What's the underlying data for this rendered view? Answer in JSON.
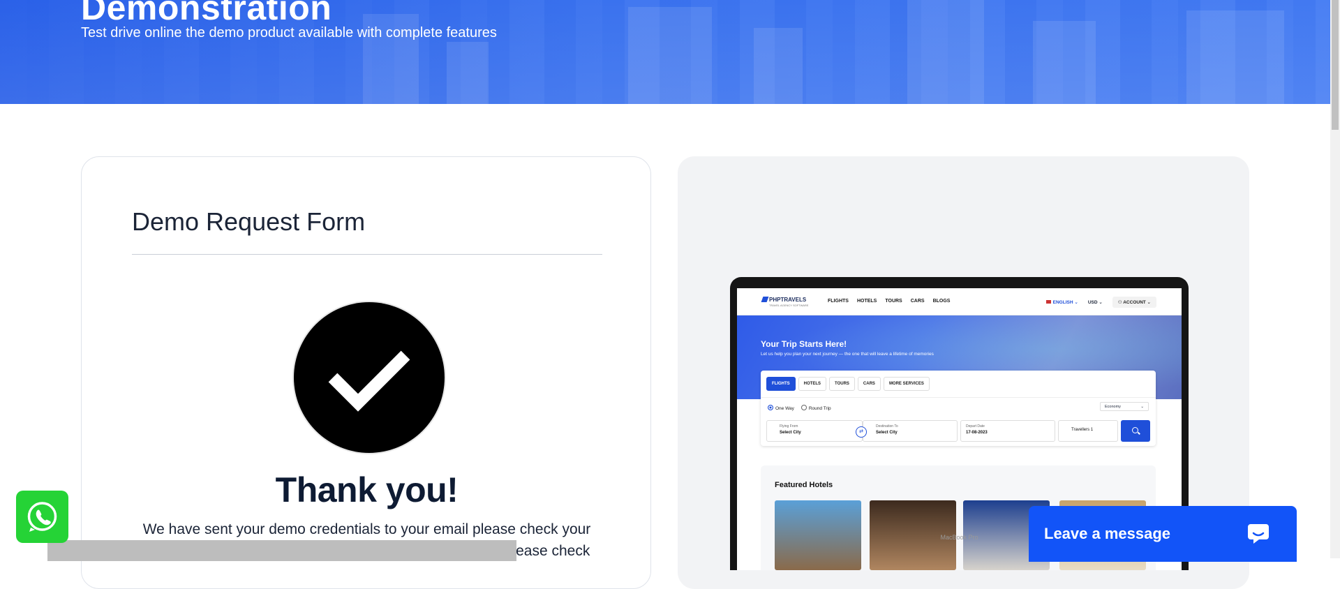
{
  "hero": {
    "title": "Demonstration",
    "subtitle": "Test drive online the demo product available with complete features"
  },
  "form": {
    "title": "Demo Request Form",
    "thanks_heading": "Thank you!",
    "thanks_message": "We have sent your demo credentials to your email please check your email to test demo website. if message not found inbox please check"
  },
  "preview": {
    "device_label": "MacBook Pro",
    "site": {
      "logo": "PHPTRAVELS",
      "logo_tagline": "TRAVEL AGENCY SOFTWARE",
      "nav": [
        "FLIGHTS",
        "HOTELS",
        "TOURS",
        "CARS",
        "BLOGS"
      ],
      "language": "ENGLISH",
      "currency": "USD",
      "account": "ACCOUNT",
      "hero_title": "Your Trip Starts Here!",
      "hero_subtitle": "Let us help you plan your next journey — the one that will leave a lifetime of memories",
      "tabs": [
        "FLIGHTS",
        "HOTELS",
        "TOURS",
        "CARS",
        "MORE SERVICES"
      ],
      "trip_types": [
        "One Way",
        "Round Trip"
      ],
      "cabin_class": "Economy",
      "flying_from_label": "Flying From",
      "flying_from_value": "Select City",
      "destination_label": "Destination To",
      "destination_value": "Select City",
      "depart_label": "Depart Date",
      "depart_value": "17-08-2023",
      "travellers": "Travellers 1",
      "featured_title": "Featured Hotels"
    }
  },
  "chat": {
    "label": "Leave a message"
  },
  "colors": {
    "brand_blue": "#1254f8",
    "whatsapp_green": "#25d336"
  }
}
